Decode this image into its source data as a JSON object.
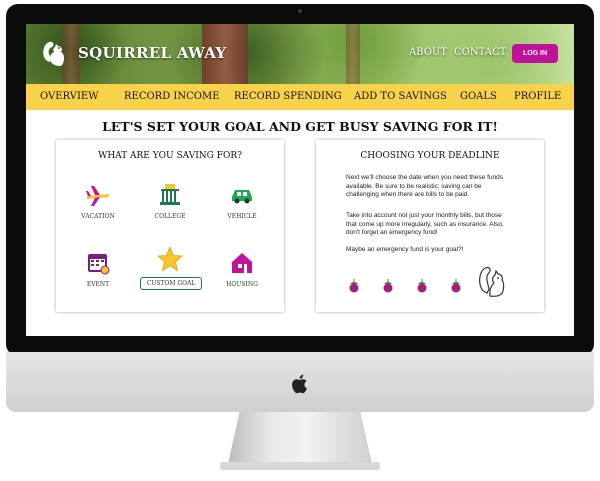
{
  "site": {
    "brand": "SQUIRREL AWAY"
  },
  "header": {
    "links": {
      "about": "ABOUT",
      "contact": "CONTACT"
    },
    "login_label": "LOG IN"
  },
  "nav": {
    "items": [
      {
        "label": "OVERVIEW"
      },
      {
        "label": "RECORD INCOME"
      },
      {
        "label": "RECORD SPENDING"
      },
      {
        "label": "ADD TO SAVINGS"
      },
      {
        "label": "GOALS"
      },
      {
        "label": "PROFILE"
      }
    ]
  },
  "main": {
    "headline": "LET'S SET YOUR GOAL AND GET BUSY SAVING FOR IT!"
  },
  "goals_card": {
    "title": "WHAT ARE YOU SAVING FOR?",
    "options": [
      {
        "label": "VACATION",
        "icon": "airplane-icon"
      },
      {
        "label": "COLLEGE",
        "icon": "college-building-icon"
      },
      {
        "label": "VEHICLE",
        "icon": "car-icon"
      },
      {
        "label": "EVENT",
        "icon": "calendar-icon"
      },
      {
        "label": "CUSTOM GOAL",
        "icon": "star-icon"
      },
      {
        "label": "HOUSING",
        "icon": "house-icon"
      }
    ]
  },
  "deadline_card": {
    "title": "CHOOSING YOUR DEADLINE",
    "paragraphs": [
      "Next we'll choose the date when you need these funds available.  Be sure to be realistic; saving can be challenging when there are bills to be paid.",
      "Take into account not just your monthly bills, but those that come up more irregularly, such as insurance. Also, don't forget an emergency fund!",
      "Maybe an emergency fund is your goal?!"
    ],
    "progress": {
      "steps_total": 4
    }
  },
  "colors": {
    "brand_magenta": "#c0139c",
    "nav_yellow": "#f7d24a",
    "accent_green": "#1b7a4a",
    "acorn_purple": "#a0207a",
    "acorn_green": "#3f8a2f"
  }
}
